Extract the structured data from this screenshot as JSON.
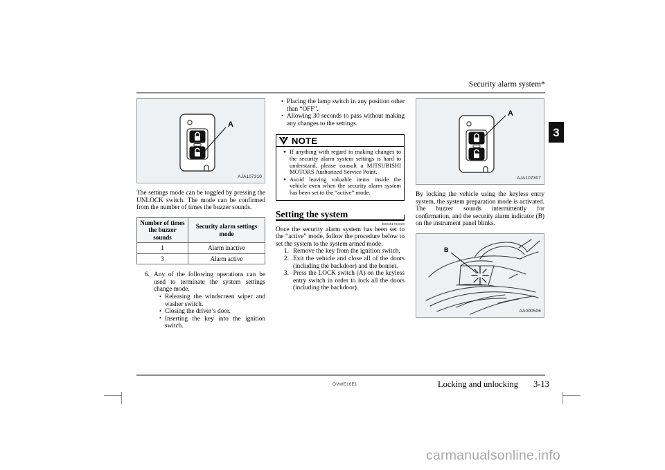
{
  "header": {
    "running_title": "Security alarm system*",
    "chapter_tab": "3"
  },
  "footer": {
    "doc_code": "OVWE16E1",
    "section": "Locking and unlocking",
    "page_number": "3-13",
    "watermark": "carmanualsonline.info"
  },
  "column1": {
    "figure": {
      "code": "AJA107310",
      "callout": "A",
      "alt_name": "key-fob-unlock-button-diagram"
    },
    "paragraph": "The settings mode can be toggled by pressing the UNLOCK switch. The mode can be confirmed from the number of times the buzzer sounds.",
    "table": {
      "headers": [
        "Number of times the buzzer sounds",
        "Security alarm settings mode"
      ],
      "rows": [
        [
          "1",
          "Alarm inactive"
        ],
        [
          "3",
          "Alarm active"
        ]
      ]
    },
    "step6": "Any of the following operations can be used to terminate the system settings change mode.",
    "step6_bullets": [
      "Releasing the windscreen wiper and washer switch.",
      "Closing the driver’s door.",
      "Inserting the key into the ignition switch."
    ]
  },
  "column2": {
    "top_bullets": [
      "Placing the lamp switch in any position other than “OFF”.",
      "Allowing 30 seconds to pass without making any changes to the settings."
    ],
    "note": {
      "title": "NOTE",
      "icon": "note-flag-icon",
      "items": [
        "If anything with regard to making changes to the security alarm system settings is hard to understand, please consult a MITSUBISHI MOTORS Authorized Service Point.",
        "Avoid leaving valuable items inside the vehicle even when the security alarm system has been set to the “active” mode."
      ]
    },
    "section": {
      "heading": "Setting the system",
      "ref_code": "E00301702028",
      "intro": "Once the security alarm system has been set to the “active” mode, follow the procedure below to set the system to the system armed mode.",
      "steps": [
        "Remove the key from the ignition switch.",
        "Exit the vehicle and close all of the doors (including the backdoor) and the bonnet.",
        "Press the LOCK switch (A) on the keyless entry switch in order to lock all the doors (including the backdoor)."
      ]
    }
  },
  "column3": {
    "figure_top": {
      "code": "AJA107307",
      "callout": "A",
      "alt_name": "key-fob-lock-button-diagram"
    },
    "paragraph": "By locking the vehicle using the keyless entry system, the system preparation mode is activated. The buzzer sounds intermittently for confirmation, and the security alarm indicator (B) on the instrument panel blinks.",
    "figure_bottom": {
      "code": "AA000506",
      "callout": "B",
      "alt_name": "instrument-panel-indicator-diagram"
    }
  },
  "colors": {
    "figure_fill": "#edf1f3",
    "figure_border": "#9a9a9a",
    "rule": "#8c8c8c",
    "tab_bg": "#111111",
    "watermark": "#a8a8a8"
  }
}
